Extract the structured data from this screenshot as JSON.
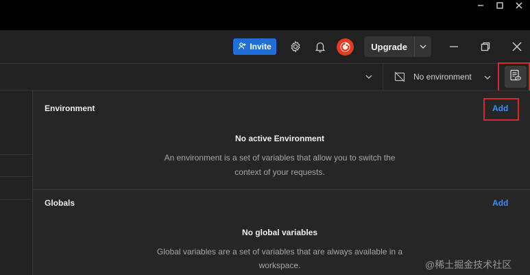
{
  "header": {
    "invite_label": "Invite",
    "upgrade_label": "Upgrade"
  },
  "toolbar": {
    "environment_selected": "No environment"
  },
  "panel": {
    "environment": {
      "title": "Environment",
      "add_label": "Add",
      "empty_title": "No active Environment",
      "empty_desc_line1": "An environment is a set of variables that allow you to switch the",
      "empty_desc_line2": "context of your requests."
    },
    "globals": {
      "title": "Globals",
      "add_label": "Add",
      "empty_title": "No global variables",
      "empty_desc_line1": "Global variables are a set of variables that are always available in a",
      "empty_desc_line2": "workspace."
    }
  },
  "watermark": "@稀土掘金技术社区",
  "colors": {
    "accent_blue": "#3d8ff5",
    "invite_bg": "#1f6fd6",
    "highlight_red": "#d82a2a",
    "avatar": "#e03b24"
  },
  "icons": [
    "minimize-icon",
    "maximize-icon",
    "close-icon",
    "add-person-icon",
    "gear-icon",
    "bell-icon",
    "chevron-down-icon",
    "restore-icon",
    "no-environment-icon",
    "environment-quick-look-icon"
  ]
}
